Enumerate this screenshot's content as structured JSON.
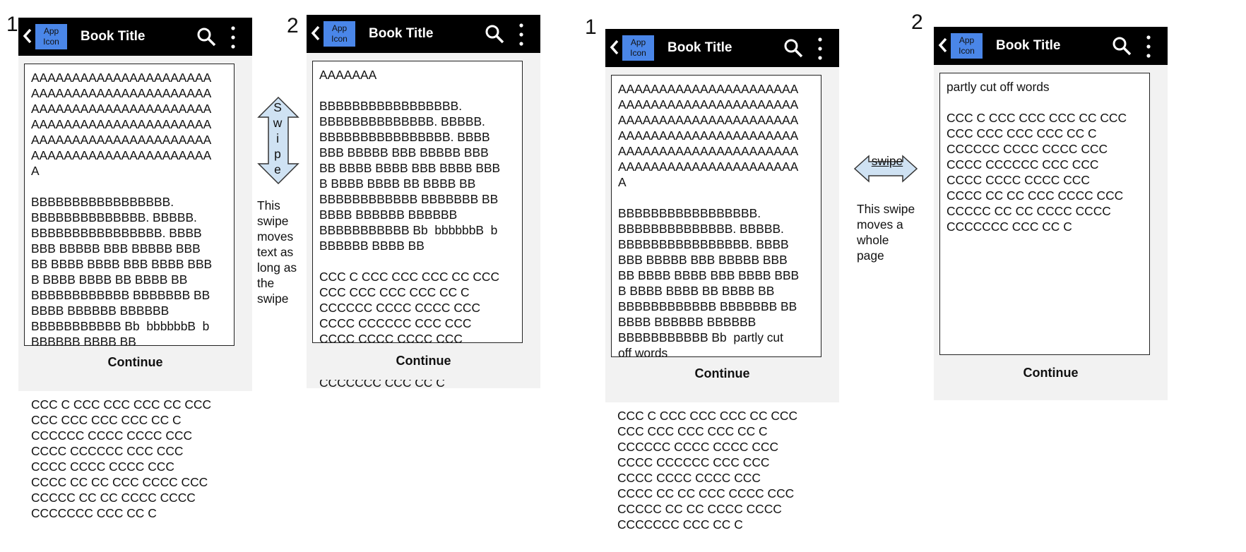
{
  "phones": [
    {
      "number": "1",
      "app_icon": "App Icon",
      "title": "Book Title",
      "continue": "Continue",
      "content": "AAAAAAAAAAAAAAAAAAAAAA\nAAAAAAAAAAAAAAAAAAAAAA\nAAAAAAAAAAAAAAAAAAAAAA\nAAAAAAAAAAAAAAAAAAAAAA\nAAAAAAAAAAAAAAAAAAAAAA\nAAAAAAAAAAAAAAAAAAAAAA\nA\n\nBBBBBBBBBBBBBBBBB.\nBBBBBBBBBBBBBB. BBBBB.\nBBBBBBBBBBBBBBBB. BBBB\nBBB BBBBB BBB BBBBB BBB\nBB BBBB BBBB BBB BBBB BBB\nB BBBB BBBB BB BBBB BB\nBBBBBBBBBBBB BBBBBBB BB\nBBBB BBBBBB BBBBBB\nBBBBBBBBBBB Bb  bbbbbbB  b\nBBBBBB BBBB BB",
      "overflow": "CCC C CCC CCC CCC CC CCC\nCCC CCC CCC CCC CC C\nCCCCCC CCCC CCCC CCC\nCCCC CCCCCC CCC CCC\nCCCC CCCC CCCC CCC\nCCCC CC CC CCC CCCC CCC\nCCCCC CC CC CCCC CCCC\nCCCCCCC CCC CC C"
    },
    {
      "number": "2",
      "app_icon": "App Icon",
      "title": "Book Title",
      "continue": "Continue",
      "content": "AAAAAAA\n\nBBBBBBBBBBBBBBBBB.\nBBBBBBBBBBBBBB. BBBBB.\nBBBBBBBBBBBBBBBB. BBBB\nBBB BBBBB BBB BBBBB BBB\nBB BBBB BBBB BBB BBBB BBB\nB BBBB BBBB BB BBBB BB\nBBBBBBBBBBBB BBBBBBB BB\nBBBB BBBBBB BBBBBB\nBBBBBBBBBBB Bb  bbbbbbB  b\nBBBBBB BBBB BB\n\nCCC C CCC CCC CCC CC CCC\nCCC CCC CCC CCC CC C\nCCCCCC CCCC CCCC CCC\nCCCC CCCCCC CCC CCC\nCCCC CCCC CCCC CCC",
      "overflow": "CCCCCCC CCC CC C"
    },
    {
      "number": "1",
      "app_icon": "App Icon",
      "title": "Book Title",
      "continue": "Continue",
      "content": "AAAAAAAAAAAAAAAAAAAAAA\nAAAAAAAAAAAAAAAAAAAAAA\nAAAAAAAAAAAAAAAAAAAAAA\nAAAAAAAAAAAAAAAAAAAAAA\nAAAAAAAAAAAAAAAAAAAAAA\nAAAAAAAAAAAAAAAAAAAAAA\nA\n\nBBBBBBBBBBBBBBBBB.\nBBBBBBBBBBBBBB. BBBBB.\nBBBBBBBBBBBBBBBB. BBBB\nBBB BBBBB BBB BBBBB BBB\nBB BBBB BBBB BBB BBBB BBB\nB BBBB BBBB BB BBBB BB\nBBBBBBBBBBBB BBBBBBB BB\nBBBB BBBBBB BBBBBB\nBBBBBBBBBBB Bb  partly cut\noff words",
      "overflow": "CCC C CCC CCC CCC CC CCC\nCCC CCC CCC CCC CC C\nCCCCCC CCCC CCCC CCC\nCCCC CCCCCC CCC CCC\nCCCC CCCC CCCC CCC\nCCCC CC CC CCC CCCC CCC\nCCCCC CC CC CCCC CCCC\nCCCCCCC CCC CC C"
    },
    {
      "number": "2",
      "app_icon": "App Icon",
      "title": "Book Title",
      "continue": "Continue",
      "content": "partly cut off words\n\nCCC C CCC CCC CCC CC CCC\nCCC CCC CCC CCC CC C\nCCCCCC CCCC CCCC CCC\nCCCC CCCCCC CCC CCC\nCCCC CCCC CCCC CCC\nCCCC CC CC CCC CCCC CCC\nCCCCC CC CC CCCC CCCC\nCCCCCCC CCC CC C",
      "overflow": ""
    }
  ],
  "swipe_vertical": {
    "arrow_label": "S\nw\ni\np\ne",
    "note": "This\nswipe\nmoves\ntext as\nlong as\nthe\nswipe"
  },
  "swipe_horizontal": {
    "arrow_label": "swipe",
    "note": "This swipe\nmoves a\nwhole\npage"
  },
  "colors": {
    "appbar": "#000000",
    "app_icon": "#4a86e8",
    "phone_bg": "#f2f2f2",
    "arrow_fill": "#cfe2f3"
  }
}
